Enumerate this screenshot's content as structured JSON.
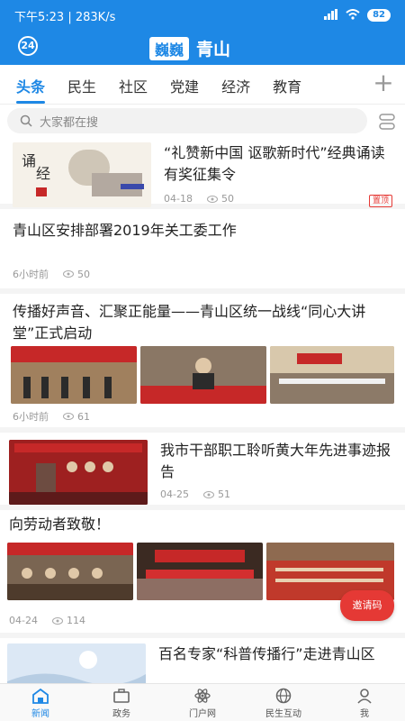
{
  "status_bar": {
    "time": "下午5:23",
    "speed": "283K/s",
    "battery": "82"
  },
  "header": {
    "badge": "24",
    "brand_logo": "巍巍",
    "brand_city": "青山"
  },
  "tabs": [
    "头条",
    "民生",
    "社区",
    "党建",
    "经济",
    "教育"
  ],
  "search": {
    "placeholder": "大家都在搜"
  },
  "feed": [
    {
      "title": "“礼赞新中国 讴歌新时代”经典诵读有奖征集令",
      "date": "04-18",
      "views": "50",
      "tag": "置顶"
    },
    {
      "title": "青山区安排部署2019年关工委工作",
      "date": "6小时前",
      "views": "50"
    },
    {
      "title": "传播好声音、汇聚正能量——青山区统一战线“同心大讲堂”正式启动",
      "date": "6小时前",
      "views": "61"
    },
    {
      "title": "我市干部职工聆听黄大年先进事迹报告",
      "date": "04-25",
      "views": "51"
    },
    {
      "title": "向劳动者致敬！",
      "date": "04-24",
      "views": "114"
    },
    {
      "title": "百名专家“科普传播行”走进青山区"
    }
  ],
  "float_button": "邀请码",
  "bottom_nav": [
    "新闻",
    "政务",
    "门户网",
    "民生互动",
    "我"
  ],
  "colors": {
    "primary": "#1e88e5",
    "accent": "#e53935"
  }
}
